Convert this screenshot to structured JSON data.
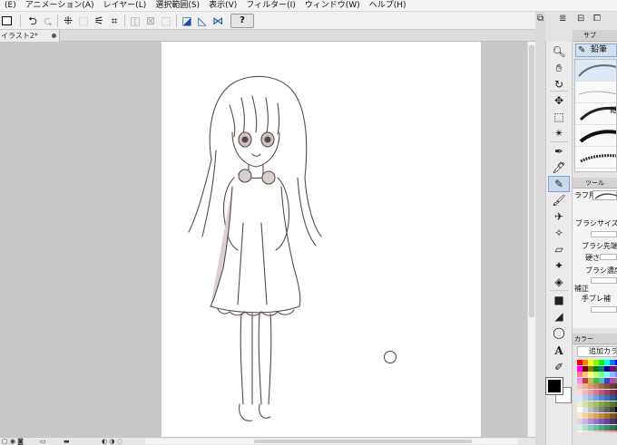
{
  "menu": [
    "(E)",
    "アニメーション(A)",
    "レイヤー(L)",
    "選択範囲(S)",
    "表示(V)",
    "フィルター(I)",
    "ウィンドウ(W)",
    "ヘルプ(H)"
  ],
  "toolbar": {
    "help_label": "?",
    "icons": [
      "undo-icon",
      "redo-icon",
      "selection-dots-icon",
      "transform-icon",
      "lasso-fill-icon",
      "crop-icon",
      "clear-icon",
      "clear-outside-icon",
      "deselect-icon",
      "vector-line-icon",
      "ruler-icon",
      "snap-icon"
    ]
  },
  "document": {
    "tab_title": "イラスト2*"
  },
  "right_panel": {
    "subtool_header": "サブ",
    "pen_tab_label": "鉛筆",
    "brush_partial_label": "鉛",
    "tool_property_header": "ツール",
    "tool_property_title": "ラフ用",
    "properties": [
      "ブラシサイズ",
      "ブラシ先端",
      "硬さ",
      "ブラシ濃度",
      "補正",
      "手ブレ補"
    ],
    "color_header": "カラー",
    "color_set_name": "追加カラ"
  },
  "colors": {
    "accent": "#7fa3cc",
    "selected_tool_bg": "#c9d9ec",
    "foreground": "#000000",
    "background": "#ffffff",
    "palette": [
      "#ff0000",
      "#ff8000",
      "#ffff00",
      "#80ff00",
      "#00ff00",
      "#00ffff",
      "#0080ff",
      "#0000ff",
      "#ff00ff",
      "#800000",
      "#808000",
      "#008000",
      "#008080",
      "#000080",
      "#800080",
      "#404040",
      "#ff8080",
      "#ffc080",
      "#ffff80",
      "#c0ff80",
      "#80ff80",
      "#80ffff",
      "#80c0ff",
      "#8080ff",
      "#ff80ff",
      "#c04040",
      "#c0c040",
      "#40c040",
      "#40c0c0",
      "#4040c0",
      "#c040c0",
      "#808080",
      "#f0c8b0",
      "#e8b090",
      "#d89878",
      "#c88060",
      "#a86848",
      "#885038",
      "#684030",
      "#483020",
      "#f8d8d8",
      "#f0b8c0",
      "#e898a8",
      "#d87890",
      "#c05878",
      "#a04060",
      "#803050",
      "#602040",
      "#d8e8f8",
      "#b8d0f0",
      "#98b8e8",
      "#78a0d8",
      "#5888c8",
      "#4070b0",
      "#305890",
      "#204070",
      "#e8f0d0",
      "#d0e0a8",
      "#b8d080",
      "#a0c060",
      "#88a848",
      "#709038",
      "#587830",
      "#406028",
      "#ffffff",
      "#e0e0e0",
      "#c0c0c0",
      "#a0a0a0",
      "#808080",
      "#606060",
      "#404040",
      "#000000",
      "#f8e8c8",
      "#f0d0a0",
      "#e8b878",
      "#d8a058",
      "#c08840",
      "#a07030",
      "#805828",
      "#604020",
      "#e0d0f0",
      "#c8b0e8",
      "#b090d8",
      "#9870c8",
      "#8058b0",
      "#684090",
      "#503070",
      "#382050",
      "#d0f0e8",
      "#a8e0d0",
      "#80d0b8",
      "#60c0a0",
      "#48a888",
      "#389070",
      "#307858",
      "#286040",
      "#fff0f0",
      "#ffe0e0",
      "#ffd0d0",
      "#ffc0c0",
      "#ffb0b0",
      "#ffa0a0",
      "#ff9090",
      "#ff8080",
      "#f0f0ff",
      "#e0e0ff",
      "#d0d0ff",
      "#c0c0ff",
      "#b0b0ff",
      "#a0a0ff",
      "#9090ff",
      "#8080ff"
    ]
  },
  "tools": [
    "zoom-icon",
    "hand-icon",
    "rotate-icon",
    "move-layer-icon",
    "select-icon",
    "magic-wand-icon",
    "eyedropper-icon",
    "pen-icon",
    "pencil-icon",
    "brush-icon",
    "airbrush-icon",
    "decoration-icon",
    "eraser-icon",
    "fill-icon",
    "gradient-icon",
    "figure-icon",
    "frame-icon",
    "text-icon",
    "balloon-icon",
    "correct-line-icon"
  ]
}
